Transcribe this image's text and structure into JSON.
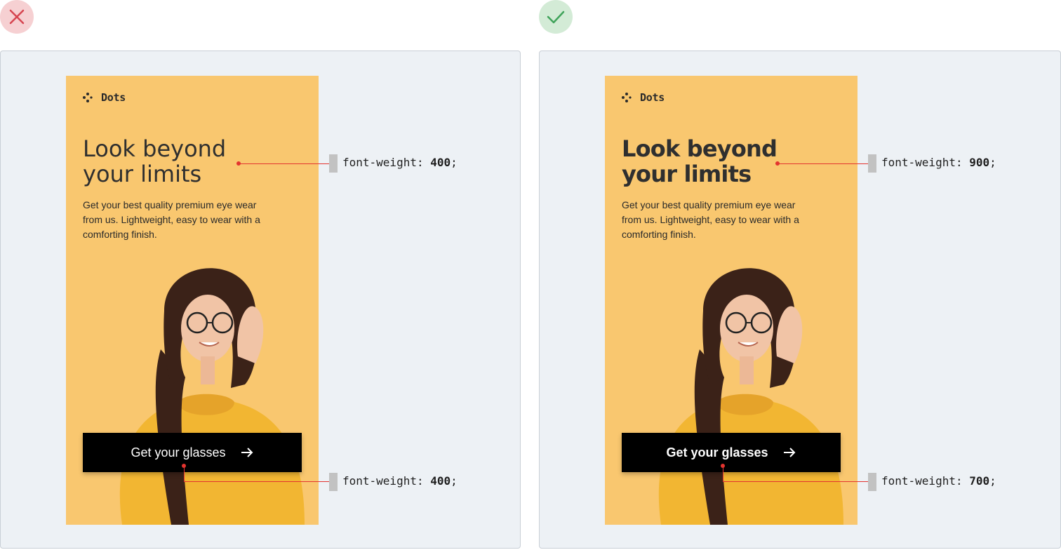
{
  "examples": [
    {
      "verdict": "incorrect",
      "verdict_color": "#d64550",
      "brand": "Dots",
      "headline_line1": "Look beyond",
      "headline_line2": "your limits",
      "body": "Get your best quality premium eye wear from us. Lightweight, easy to wear with a comforting finish.",
      "cta_label": "Get your glasses",
      "headline_weight_prefix": "font-weight: ",
      "headline_weight_value": "400",
      "cta_weight_prefix": "font-weight: ",
      "cta_weight_value": "400",
      "suffix": ";"
    },
    {
      "verdict": "correct",
      "verdict_color": "#3fa35a",
      "brand": "Dots",
      "headline_line1": "Look beyond",
      "headline_line2": "your limits",
      "body": "Get your best quality premium eye wear from us. Lightweight, easy to wear with a comforting finish.",
      "cta_label": "Get your glasses",
      "headline_weight_prefix": "font-weight: ",
      "headline_weight_value": "900",
      "cta_weight_prefix": "font-weight: ",
      "cta_weight_value": "700",
      "suffix": ";"
    }
  ],
  "colors": {
    "card_background": "#f9c76f",
    "panel_background": "#edf1f5",
    "callout": "#e3342f",
    "sweater": "#f2b632",
    "hair": "#3b2218"
  }
}
